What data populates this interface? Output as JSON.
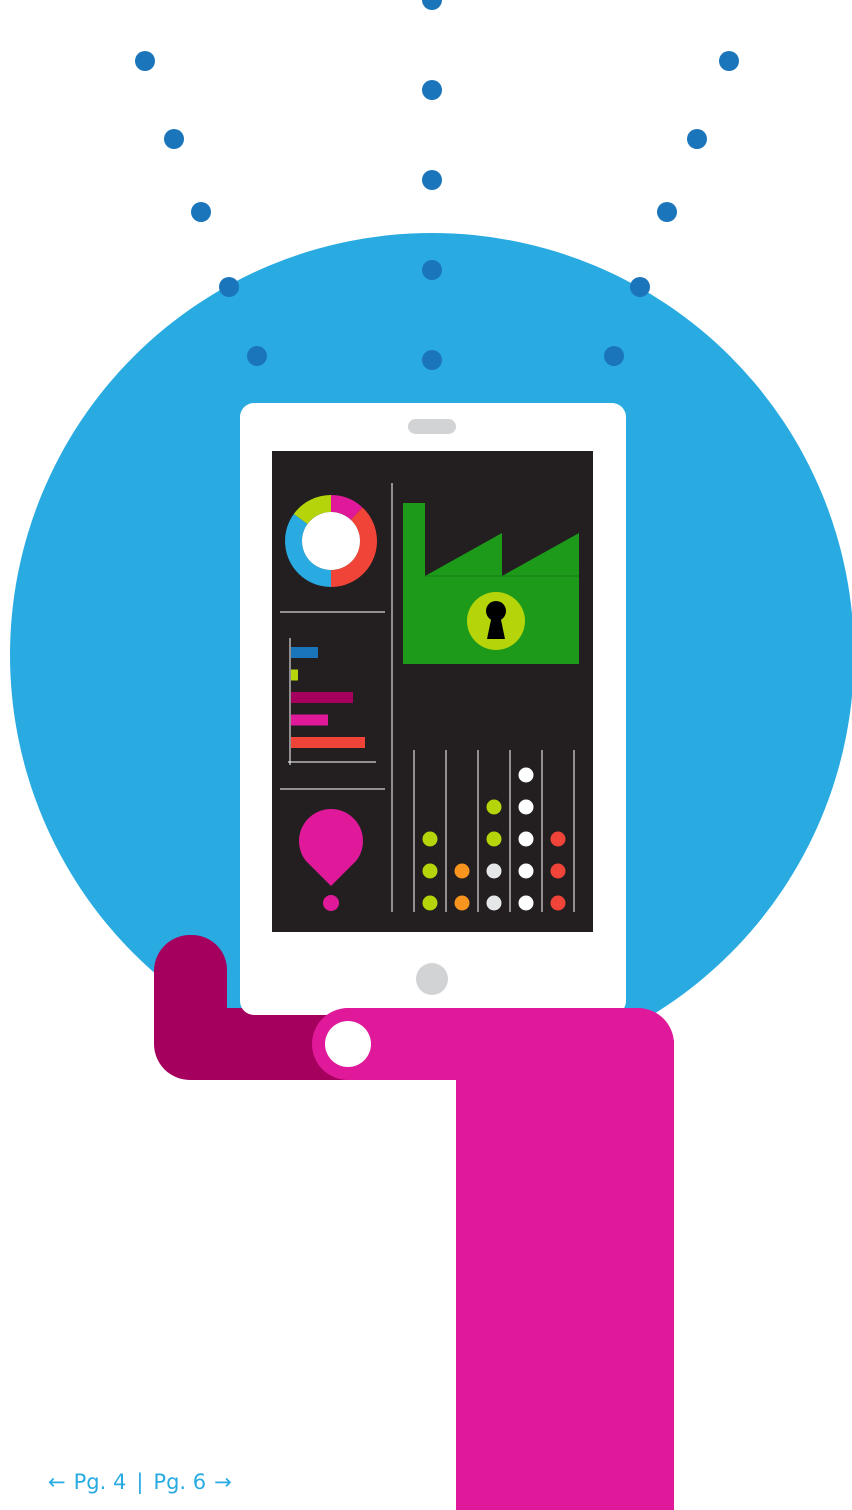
{
  "navigation": {
    "prev_arrow": "←",
    "prev_label": "Pg. 4",
    "separator": "|",
    "next_label": "Pg. 6",
    "next_arrow": "→"
  },
  "colors": {
    "sky_blue": "#29abe2",
    "dot_blue": "#1b75bb",
    "magenta": "#e0199a",
    "dark_magenta": "#a5005e",
    "screen_dark": "#231f20",
    "factory_green": "#1d9a1a",
    "lime": "#b5d50a",
    "red": "#f04438",
    "orange": "#f7941d",
    "device_white": "#ffffff",
    "device_gray": "#d1d3d4"
  },
  "illustration": {
    "description_icons": [
      "signal-dots-icon",
      "tablet-icon",
      "donut-chart-icon",
      "bar-chart-icon",
      "location-pin-icon",
      "factory-icon",
      "keyhole-lock-icon",
      "dot-matrix-chart-icon",
      "hand-icon"
    ],
    "donut_shares": [
      {
        "color": "#e0199a",
        "fraction": 0.12
      },
      {
        "color": "#f04438",
        "fraction": 0.38
      },
      {
        "color": "#29abe2",
        "fraction": 0.35
      },
      {
        "color": "#b5d50a",
        "fraction": 0.15
      }
    ],
    "bars": [
      {
        "color": "#1b75bb",
        "value": 27
      },
      {
        "color": "#b5d50a",
        "value": 7
      },
      {
        "color": "#a5005e",
        "value": 62
      },
      {
        "color": "#e0199a",
        "value": 37
      },
      {
        "color": "#f04438",
        "value": 74
      }
    ],
    "dot_columns": [
      {
        "color": "#b5d50a",
        "count": 3
      },
      {
        "color": "#f7941d",
        "count": 2
      },
      {
        "color": "mixed-lime-white",
        "count": 4
      },
      {
        "color": "#ffffff",
        "count": 5
      },
      {
        "color": "#f04438",
        "count": 3
      }
    ]
  }
}
